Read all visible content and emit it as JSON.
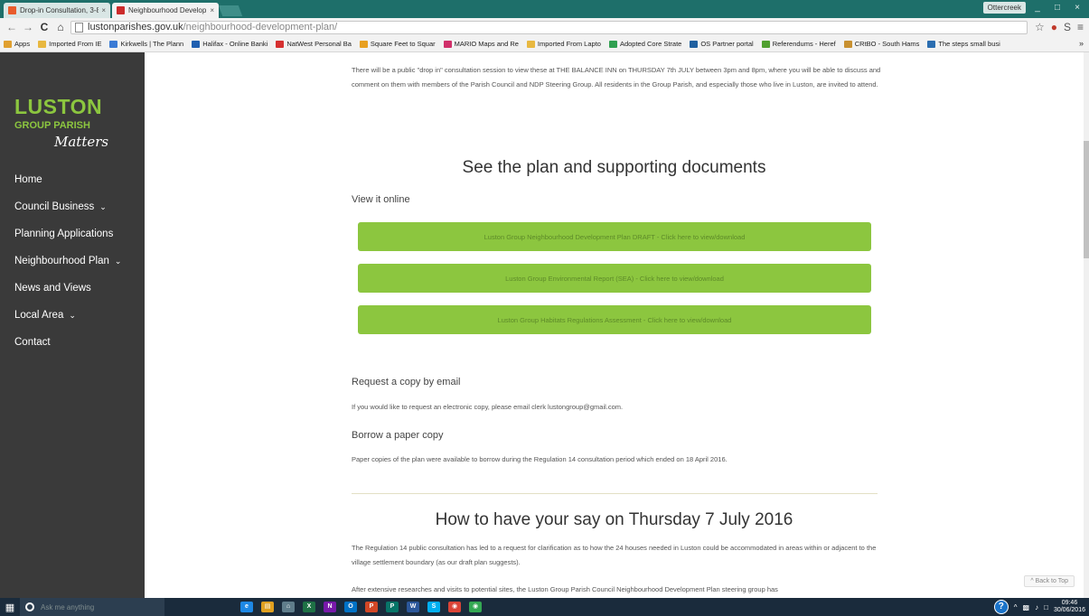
{
  "browser": {
    "tabs": [
      {
        "label": "Drop-in Consultation, 3-8",
        "close": "×",
        "active": false,
        "favicon_color": "#e85c2c"
      },
      {
        "label": "Neighbourhood Develop",
        "close": "×",
        "active": true,
        "favicon_color": "#cc2b2b"
      }
    ],
    "profile_label": "Ottercreek",
    "url_host": "lustonparishes.gov.uk",
    "url_path": "/neighbourhood-development-plan/",
    "bookmarks": [
      {
        "label": "Apps",
        "color": "#e0a030"
      },
      {
        "label": "Imported From IE",
        "color": "#e8b840"
      },
      {
        "label": "Kirkwells | The Plann",
        "color": "#3a7bd5"
      },
      {
        "label": "Halifax - Online Banki",
        "color": "#1f5fb0"
      },
      {
        "label": "NatWest Personal Ba",
        "color": "#d63030"
      },
      {
        "label": "Square Feet to Squar",
        "color": "#e8a020"
      },
      {
        "label": "MARIO Maps and Re",
        "color": "#d0306a"
      },
      {
        "label": "Imported From Lapto",
        "color": "#e8b840"
      },
      {
        "label": "Adopted Core Strate",
        "color": "#30a050"
      },
      {
        "label": "OS Partner portal",
        "color": "#2060a0"
      },
      {
        "label": "Referendums - Heref",
        "color": "#50a030"
      },
      {
        "label": "CRtBO - South Hams",
        "color": "#c89030"
      },
      {
        "label": "The steps small busi",
        "color": "#2a6db0"
      }
    ],
    "bookmarks_more": "»",
    "window_controls": [
      "_",
      "□",
      "×"
    ]
  },
  "sidebar": {
    "logo_line1": "LUSTON",
    "logo_line2": "GROUP PARISH",
    "logo_line3": "Matters",
    "items": [
      {
        "label": "Home",
        "has_children": false
      },
      {
        "label": "Council Business",
        "has_children": true
      },
      {
        "label": "Planning Applications",
        "has_children": false
      },
      {
        "label": "Neighbourhood Plan",
        "has_children": true
      },
      {
        "label": "News and Views",
        "has_children": false
      },
      {
        "label": "Local Area",
        "has_children": true
      },
      {
        "label": "Contact",
        "has_children": false
      }
    ]
  },
  "main": {
    "intro": "There will be a public \"drop in\" consultation session to view these at THE BALANCE INN on THURSDAY 7th JULY between 3pm and 8pm, where you will be able to discuss and comment on them with members of the Parish Council and NDP Steering Group. All residents in the Group Parish, and especially those who live in Luston, are invited to attend.",
    "plan_heading": "See the plan and supporting documents",
    "view_online_label": "View it online",
    "doc_buttons": [
      "Luston Group Neighbourhood Development Plan DRAFT - Click here to view/download",
      "Luston Group Environmental Report (SEA) - Click here to view/download",
      "Luston Group Habitats Regulations Assessment - Click here to view/download"
    ],
    "request_heading": "Request a copy by email",
    "request_text": "If you would like to request an electronic copy, please email clerk lustongroup@gmail.com.",
    "borrow_heading": "Borrow a paper copy",
    "borrow_text": "Paper copies of the plan were available to borrow during the Regulation 14 consultation period which ended on 18 April 2016.",
    "say_heading": "How to have your say on Thursday 7 July 2016",
    "para1": "The Regulation 14 public consultation has led to a request for clarification as to how the 24 houses needed in Luston could be accommodated in areas within or adjacent to the village settlement boundary (as our draft plan suggests).",
    "para2": "After extensive researches and visits to potential sites, the Luston Group Parish Council Neighbourhood Development Plan steering group has",
    "back_to_top": "^ Back to Top"
  },
  "taskbar": {
    "search_placeholder": "Ask me anything",
    "apps": [
      {
        "label": "e",
        "color": "#1e88e5"
      },
      {
        "label": "▤",
        "color": "#e0a020"
      },
      {
        "label": "⌂",
        "color": "#607d8b"
      },
      {
        "label": "X",
        "color": "#1e7145"
      },
      {
        "label": "N",
        "color": "#7719aa"
      },
      {
        "label": "O",
        "color": "#0072c6"
      },
      {
        "label": "P",
        "color": "#d24726"
      },
      {
        "label": "P",
        "color": "#077568"
      },
      {
        "label": "W",
        "color": "#2b579a"
      },
      {
        "label": "S",
        "color": "#00aff0"
      },
      {
        "label": "◉",
        "color": "#db4437"
      },
      {
        "label": "◉",
        "color": "#34a853"
      }
    ],
    "help": "?",
    "time": "09:46",
    "date": "30/06/2016"
  }
}
